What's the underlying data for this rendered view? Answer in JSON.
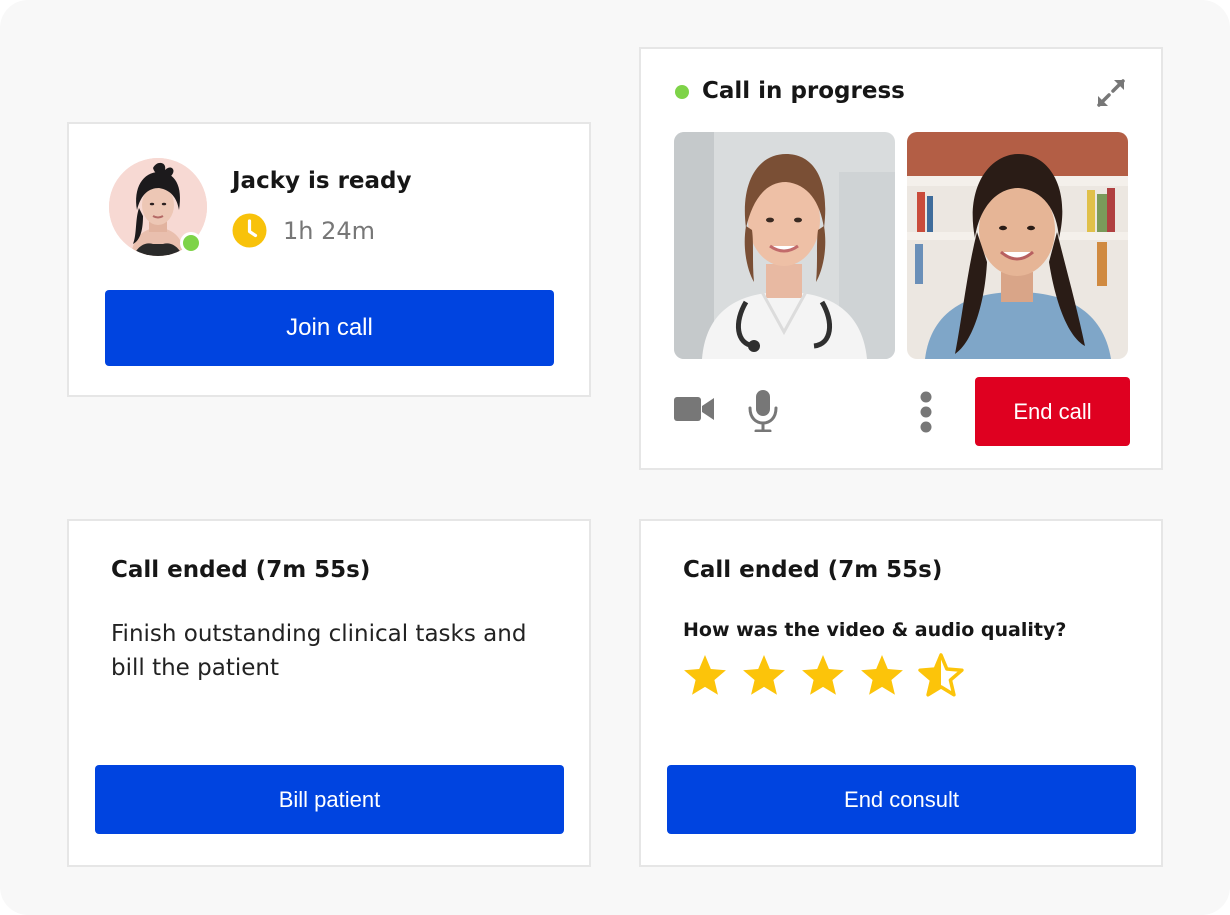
{
  "ready_card": {
    "title": "Jacky is ready",
    "wait_time": "1h 24m",
    "join_label": "Join call",
    "status": "online"
  },
  "call_card": {
    "title": "Call in progress",
    "end_label": "End call",
    "icons": [
      "expand-icon",
      "video-camera-icon",
      "microphone-icon",
      "more-vertical-icon"
    ]
  },
  "ended_card": {
    "title": "Call ended (7m 55s)",
    "message": "Finish outstanding clinical tasks and bill the patient",
    "bill_label": "Bill patient"
  },
  "rating_card": {
    "title": "Call ended (7m 55s)",
    "question": "How was the video & audio quality?",
    "rating": 4.5,
    "rating_max": 5,
    "end_label": "End consult"
  },
  "colors": {
    "primary": "#0044e0",
    "danger": "#df0020",
    "online": "#7ed348",
    "star": "#fcc40a",
    "background": "#f8f8f8"
  }
}
